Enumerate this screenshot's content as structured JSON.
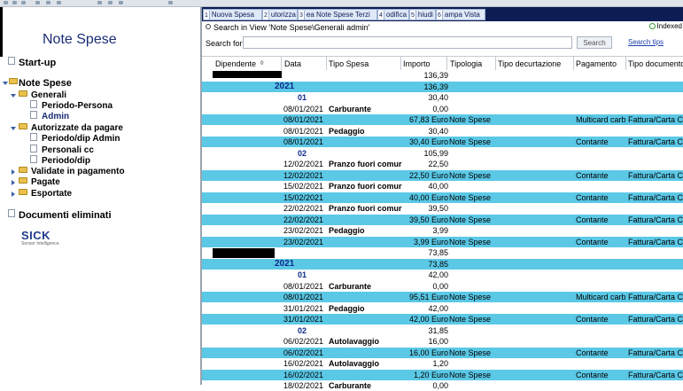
{
  "nav": {
    "app_title": "Note Spese",
    "items": [
      {
        "label": "Start-up"
      },
      {
        "label": "Note Spese"
      },
      {
        "label": "Generali"
      },
      {
        "label": "Periodo-Persona"
      },
      {
        "label": "Admin"
      },
      {
        "label": "Autorizzate da pagare"
      },
      {
        "label": "Periodo/dip Admin"
      },
      {
        "label": "Personali cc"
      },
      {
        "label": "Periodo/dip"
      },
      {
        "label": "Validate in pagamento"
      },
      {
        "label": "Pagate"
      },
      {
        "label": "Esportate"
      },
      {
        "label": "Documenti eliminati"
      }
    ],
    "logo": {
      "word": "SICK",
      "sub": "Sensor Intelligence."
    }
  },
  "toolbar": {
    "buttons": [
      {
        "num": "1",
        "label": "Nuova Spesa"
      },
      {
        "num": "2",
        "label": "utorizza"
      },
      {
        "num": "3",
        "label": "ea Note Spese Terzi"
      },
      {
        "num": "4",
        "label": "odifica"
      },
      {
        "num": "5",
        "label": "hiudi"
      },
      {
        "num": "6",
        "label": "ampa Vista"
      }
    ]
  },
  "search": {
    "heading": "Search in View 'Note Spese\\Generali admin'",
    "indexed": "Indexed",
    "label": "Search for",
    "value": "",
    "button": "Search",
    "tips": "Search tips"
  },
  "grid": {
    "columns": [
      "Dipendente",
      "Data",
      "Tipo Spesa",
      "Importo",
      "Tipologia",
      "Tipo decurtazione",
      "Pagamento",
      "Tipo documento"
    ],
    "rows": [
      {
        "kind": "total",
        "amount": "136,39"
      },
      {
        "kind": "year",
        "label": "2021",
        "amount": "136,39"
      },
      {
        "kind": "month",
        "label": "01",
        "amount": "30,40"
      },
      {
        "kind": "cat",
        "date": "08/01/2021",
        "type": "Carburante",
        "amount": "0,00"
      },
      {
        "kind": "line",
        "date": "08/01/2021",
        "amount": "67,83 Euro",
        "tipologia": "Note Spese",
        "pagamento": "Multicard carb",
        "tipodoc": "Fattura/Carta C"
      },
      {
        "kind": "cat",
        "date": "08/01/2021",
        "type": "Pedaggio",
        "amount": "30,40"
      },
      {
        "kind": "line",
        "date": "08/01/2021",
        "amount": "30,40 Euro",
        "tipologia": "Note Spese",
        "pagamento": "Contante",
        "tipodoc": "Fattura/Carta C"
      },
      {
        "kind": "month",
        "label": "02",
        "amount": "105,99"
      },
      {
        "kind": "cat",
        "date": "12/02/2021",
        "type": "Pranzo fuori comur",
        "amount": "22,50"
      },
      {
        "kind": "line",
        "date": "12/02/2021",
        "amount": "22,50 Euro",
        "tipologia": "Note Spese",
        "pagamento": "Contante",
        "tipodoc": "Fattura/Carta C"
      },
      {
        "kind": "cat",
        "date": "15/02/2021",
        "type": "Pranzo fuori comur",
        "amount": "40,00"
      },
      {
        "kind": "line",
        "date": "15/02/2021",
        "amount": "40,00 Euro",
        "tipologia": "Note Spese",
        "pagamento": "Contante",
        "tipodoc": "Fattura/Carta C"
      },
      {
        "kind": "cat",
        "date": "22/02/2021",
        "type": "Pranzo fuori comur",
        "amount": "39,50"
      },
      {
        "kind": "line",
        "date": "22/02/2021",
        "amount": "39,50 Euro",
        "tipologia": "Note Spese",
        "pagamento": "Contante",
        "tipodoc": "Fattura/Carta C"
      },
      {
        "kind": "cat",
        "date": "23/02/2021",
        "type": "Pedaggio",
        "amount": "3,99"
      },
      {
        "kind": "line",
        "date": "23/02/2021",
        "amount": "3,99 Euro",
        "tipologia": "Note Spese",
        "pagamento": "Contante",
        "tipodoc": "Fattura/Carta C"
      },
      {
        "kind": "total",
        "amount": "73,85"
      },
      {
        "kind": "year",
        "label": "2021",
        "amount": "73,85"
      },
      {
        "kind": "month",
        "label": "01",
        "amount": "42,00"
      },
      {
        "kind": "cat",
        "date": "08/01/2021",
        "type": "Carburante",
        "amount": "0,00"
      },
      {
        "kind": "line",
        "date": "08/01/2021",
        "amount": "95,51 Euro",
        "tipologia": "Note Spese",
        "pagamento": "Multicard carb",
        "tipodoc": "Fattura/Carta C"
      },
      {
        "kind": "cat",
        "date": "31/01/2021",
        "type": "Pedaggio",
        "amount": "42,00"
      },
      {
        "kind": "line",
        "date": "31/01/2021",
        "amount": "42,00 Euro",
        "tipologia": "Note Spese",
        "pagamento": "Contante",
        "tipodoc": "Fattura/Carta C"
      },
      {
        "kind": "month",
        "label": "02",
        "amount": "31,85"
      },
      {
        "kind": "cat",
        "date": "06/02/2021",
        "type": "Autolavaggio",
        "amount": "16,00"
      },
      {
        "kind": "line",
        "date": "06/02/2021",
        "amount": "16,00 Euro",
        "tipologia": "Note Spese",
        "pagamento": "Contante",
        "tipodoc": "Fattura/Carta C"
      },
      {
        "kind": "cat",
        "date": "16/02/2021",
        "type": "Autolavaggio",
        "amount": "1,20"
      },
      {
        "kind": "line",
        "date": "16/02/2021",
        "amount": "1,20 Euro",
        "tipologia": "Note Spese",
        "pagamento": "Contante",
        "tipodoc": "Fattura/Carta C"
      },
      {
        "kind": "cat",
        "date": "18/02/2021",
        "type": "Carburante",
        "amount": "0,00"
      }
    ]
  }
}
